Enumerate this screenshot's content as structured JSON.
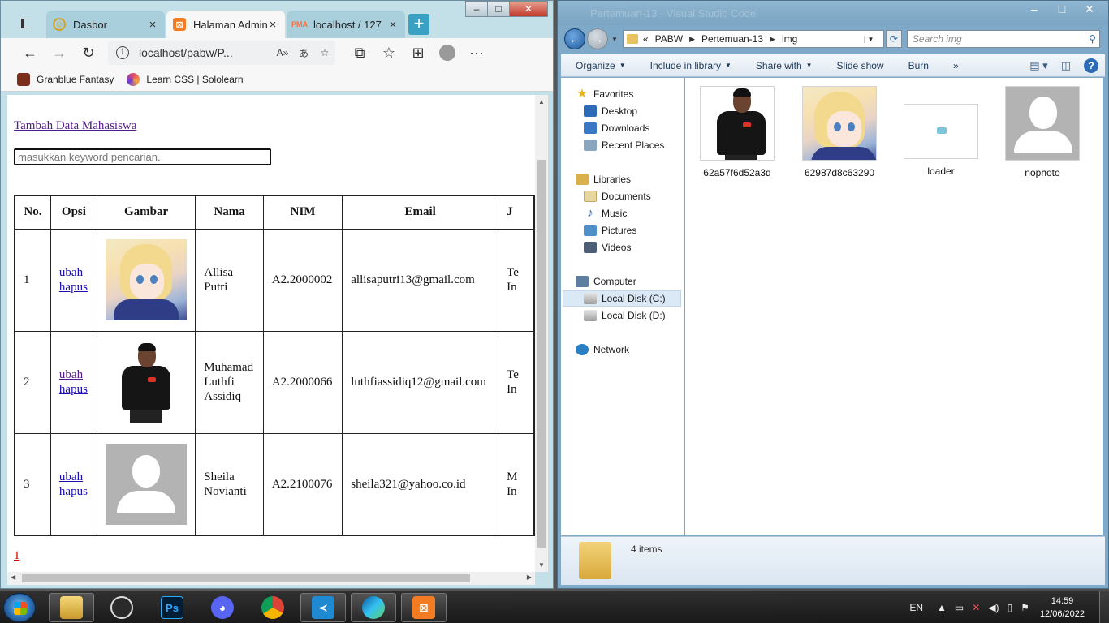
{
  "browser": {
    "tabs": [
      {
        "title": "Dasbor",
        "active": false
      },
      {
        "title": "Halaman Admin",
        "active": true
      },
      {
        "title": "localhost / 127",
        "active": false
      }
    ],
    "address": "localhost/pabw/P...",
    "bookmarks": [
      "Granblue Fantasy",
      "Learn CSS | Sololearn"
    ],
    "window_buttons": {
      "min": "–",
      "max": "□",
      "close": "✕"
    }
  },
  "page": {
    "add_link": "Tambah Data Mahasiswa",
    "search_placeholder": "masukkan keyword pencarian..",
    "table": {
      "headers": [
        "No.",
        "Opsi",
        "Gambar",
        "Nama",
        "NIM",
        "Email",
        "J"
      ],
      "rows": [
        {
          "no": "1",
          "edit": "ubah",
          "delete": "hapus",
          "image": "anime-girl",
          "nama": "Allisa Putri",
          "nim": "A2.2000002",
          "email": "allisaputri13@gmail.com",
          "jur": "Te In"
        },
        {
          "no": "2",
          "edit": "ubah",
          "delete": "hapus",
          "image": "man-black-shirt",
          "nama": "Muhamad Luthfi Assidiq",
          "nim": "A2.2000066",
          "email": "luthfiassidiq12@gmail.com",
          "jur": "Te In"
        },
        {
          "no": "3",
          "edit": "ubah",
          "delete": "hapus",
          "image": "nophoto",
          "nama": "Sheila Novianti",
          "nim": "A2.2100076",
          "email": "sheila321@yahoo.co.id",
          "jur": "M In"
        }
      ]
    },
    "pagination": "1"
  },
  "explorer": {
    "title_ghost": "Pertemuan-13 - Visual Studio Code",
    "breadcrumb": [
      "«",
      "PABW",
      "Pertemuan-13",
      "img"
    ],
    "search_placeholder": "Search img",
    "commands": [
      "Organize",
      "Include in library",
      "Share with",
      "Slide show",
      "Burn",
      "»"
    ],
    "nav": {
      "favorites": "Favorites",
      "favorites_items": [
        "Desktop",
        "Downloads",
        "Recent Places"
      ],
      "libraries": "Libraries",
      "libraries_items": [
        "Documents",
        "Music",
        "Pictures",
        "Videos"
      ],
      "computer": "Computer",
      "computer_items": [
        "Local Disk (C:)",
        "Local Disk (D:)"
      ],
      "network": "Network"
    },
    "files": [
      "62a57f6d52a3d",
      "62987d8c63290",
      "loader",
      "nophoto"
    ],
    "status": "4 items"
  },
  "taskbar": {
    "apps": [
      "windows-explorer",
      "snipping-tool",
      "photoshop",
      "discord",
      "chrome",
      "vscode",
      "edge",
      "xampp"
    ],
    "language": "EN",
    "time": "14:59",
    "date": "12/06/2022"
  }
}
